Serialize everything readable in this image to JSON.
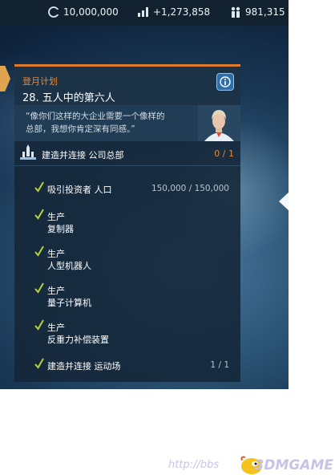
{
  "resources": {
    "credits": "10,000,000",
    "growth": "+1,273,858",
    "population": "981,315"
  },
  "mission": {
    "category": "登月计划",
    "title": "28. 五人中的第六人",
    "quote_line1": "“像你们这样的大企业需要一个像样的",
    "quote_line2": "总部，我想你肯定深有同感。”"
  },
  "objective": {
    "label": "建造并连接 公司总部",
    "count": "0 / 1",
    "subtasks": [
      {
        "line1": "吸引投资者 人口",
        "line2": "",
        "count": "150,000 / 150,000",
        "done": true
      },
      {
        "line1": "生产",
        "line2": "复制器",
        "count": "",
        "done": true
      },
      {
        "line1": "生产",
        "line2": "人型机器人",
        "count": "",
        "done": true
      },
      {
        "line1": "生产",
        "line2": "量子计算机",
        "count": "",
        "done": true
      },
      {
        "line1": "生产",
        "line2": "反重力补偿装置",
        "count": "",
        "done": true
      },
      {
        "line1": "建造并连接 运动场",
        "line2": "",
        "count": "1 / 1",
        "done": true
      }
    ]
  },
  "icons": {
    "credits": "credits-icon",
    "growth": "bar-chart-icon",
    "population": "population-icon",
    "info": "info-icon",
    "objective": "building-icon",
    "check": "checkmark-icon"
  },
  "colors": {
    "accent": "#e07a2c",
    "check": "#b9d334",
    "info": "#2f6ea7"
  },
  "watermark": {
    "url": "http://bbs",
    "brand": "3DMGAME"
  }
}
